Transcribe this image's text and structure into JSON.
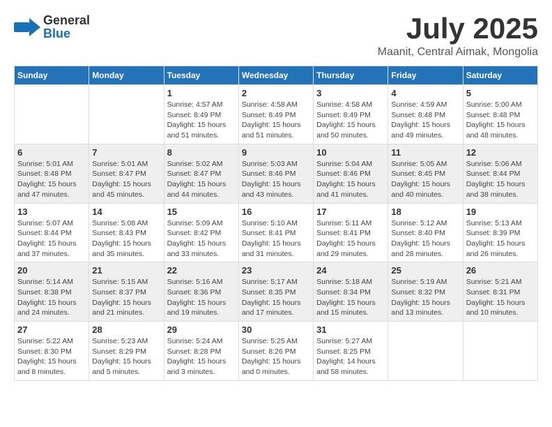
{
  "header": {
    "logo": {
      "general": "General",
      "blue": "Blue"
    },
    "month": "July 2025",
    "location": "Maanit, Central Aimak, Mongolia"
  },
  "weekdays": [
    "Sunday",
    "Monday",
    "Tuesday",
    "Wednesday",
    "Thursday",
    "Friday",
    "Saturday"
  ],
  "weeks": [
    [
      {
        "day": "",
        "info": ""
      },
      {
        "day": "",
        "info": ""
      },
      {
        "day": "1",
        "info": "Sunrise: 4:57 AM\nSunset: 8:49 PM\nDaylight: 15 hours\nand 51 minutes."
      },
      {
        "day": "2",
        "info": "Sunrise: 4:58 AM\nSunset: 8:49 PM\nDaylight: 15 hours\nand 51 minutes."
      },
      {
        "day": "3",
        "info": "Sunrise: 4:58 AM\nSunset: 8:49 PM\nDaylight: 15 hours\nand 50 minutes."
      },
      {
        "day": "4",
        "info": "Sunrise: 4:59 AM\nSunset: 8:48 PM\nDaylight: 15 hours\nand 49 minutes."
      },
      {
        "day": "5",
        "info": "Sunrise: 5:00 AM\nSunset: 8:48 PM\nDaylight: 15 hours\nand 48 minutes."
      }
    ],
    [
      {
        "day": "6",
        "info": "Sunrise: 5:01 AM\nSunset: 8:48 PM\nDaylight: 15 hours\nand 47 minutes."
      },
      {
        "day": "7",
        "info": "Sunrise: 5:01 AM\nSunset: 8:47 PM\nDaylight: 15 hours\nand 45 minutes."
      },
      {
        "day": "8",
        "info": "Sunrise: 5:02 AM\nSunset: 8:47 PM\nDaylight: 15 hours\nand 44 minutes."
      },
      {
        "day": "9",
        "info": "Sunrise: 5:03 AM\nSunset: 8:46 PM\nDaylight: 15 hours\nand 43 minutes."
      },
      {
        "day": "10",
        "info": "Sunrise: 5:04 AM\nSunset: 8:46 PM\nDaylight: 15 hours\nand 41 minutes."
      },
      {
        "day": "11",
        "info": "Sunrise: 5:05 AM\nSunset: 8:45 PM\nDaylight: 15 hours\nand 40 minutes."
      },
      {
        "day": "12",
        "info": "Sunrise: 5:06 AM\nSunset: 8:44 PM\nDaylight: 15 hours\nand 38 minutes."
      }
    ],
    [
      {
        "day": "13",
        "info": "Sunrise: 5:07 AM\nSunset: 8:44 PM\nDaylight: 15 hours\nand 37 minutes."
      },
      {
        "day": "14",
        "info": "Sunrise: 5:08 AM\nSunset: 8:43 PM\nDaylight: 15 hours\nand 35 minutes."
      },
      {
        "day": "15",
        "info": "Sunrise: 5:09 AM\nSunset: 8:42 PM\nDaylight: 15 hours\nand 33 minutes."
      },
      {
        "day": "16",
        "info": "Sunrise: 5:10 AM\nSunset: 8:41 PM\nDaylight: 15 hours\nand 31 minutes."
      },
      {
        "day": "17",
        "info": "Sunrise: 5:11 AM\nSunset: 8:41 PM\nDaylight: 15 hours\nand 29 minutes."
      },
      {
        "day": "18",
        "info": "Sunrise: 5:12 AM\nSunset: 8:40 PM\nDaylight: 15 hours\nand 28 minutes."
      },
      {
        "day": "19",
        "info": "Sunrise: 5:13 AM\nSunset: 8:39 PM\nDaylight: 15 hours\nand 26 minutes."
      }
    ],
    [
      {
        "day": "20",
        "info": "Sunrise: 5:14 AM\nSunset: 8:38 PM\nDaylight: 15 hours\nand 24 minutes."
      },
      {
        "day": "21",
        "info": "Sunrise: 5:15 AM\nSunset: 8:37 PM\nDaylight: 15 hours\nand 21 minutes."
      },
      {
        "day": "22",
        "info": "Sunrise: 5:16 AM\nSunset: 8:36 PM\nDaylight: 15 hours\nand 19 minutes."
      },
      {
        "day": "23",
        "info": "Sunrise: 5:17 AM\nSunset: 8:35 PM\nDaylight: 15 hours\nand 17 minutes."
      },
      {
        "day": "24",
        "info": "Sunrise: 5:18 AM\nSunset: 8:34 PM\nDaylight: 15 hours\nand 15 minutes."
      },
      {
        "day": "25",
        "info": "Sunrise: 5:19 AM\nSunset: 8:32 PM\nDaylight: 15 hours\nand 13 minutes."
      },
      {
        "day": "26",
        "info": "Sunrise: 5:21 AM\nSunset: 8:31 PM\nDaylight: 15 hours\nand 10 minutes."
      }
    ],
    [
      {
        "day": "27",
        "info": "Sunrise: 5:22 AM\nSunset: 8:30 PM\nDaylight: 15 hours\nand 8 minutes."
      },
      {
        "day": "28",
        "info": "Sunrise: 5:23 AM\nSunset: 8:29 PM\nDaylight: 15 hours\nand 5 minutes."
      },
      {
        "day": "29",
        "info": "Sunrise: 5:24 AM\nSunset: 8:28 PM\nDaylight: 15 hours\nand 3 minutes."
      },
      {
        "day": "30",
        "info": "Sunrise: 5:25 AM\nSunset: 8:26 PM\nDaylight: 15 hours\nand 0 minutes."
      },
      {
        "day": "31",
        "info": "Sunrise: 5:27 AM\nSunset: 8:25 PM\nDaylight: 14 hours\nand 58 minutes."
      },
      {
        "day": "",
        "info": ""
      },
      {
        "day": "",
        "info": ""
      }
    ]
  ]
}
